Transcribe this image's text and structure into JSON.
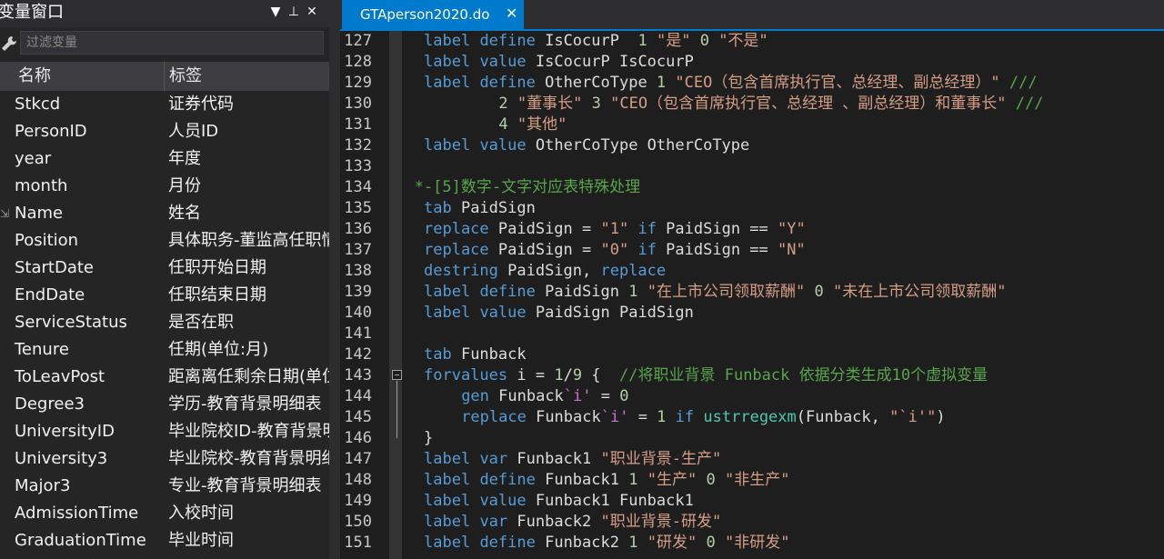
{
  "var_panel": {
    "title": "变量窗口",
    "buttons": {
      "filter": "▼",
      "pin": "⊥",
      "close": "✕"
    },
    "filter_placeholder": "过滤变量",
    "columns": {
      "name": "名称",
      "label": "标签"
    },
    "rows": [
      {
        "name": "Stkcd",
        "label": "证券代码"
      },
      {
        "name": "PersonID",
        "label": "人员ID"
      },
      {
        "name": "year",
        "label": "年度"
      },
      {
        "name": "month",
        "label": "月份"
      },
      {
        "name": "Name",
        "label": "姓名"
      },
      {
        "name": "Position",
        "label": "具体职务-董监高任职情"
      },
      {
        "name": "StartDate",
        "label": "任职开始日期"
      },
      {
        "name": "EndDate",
        "label": "任职结束日期"
      },
      {
        "name": "ServiceStatus",
        "label": "是否在职"
      },
      {
        "name": "Tenure",
        "label": "任期(单位:月)"
      },
      {
        "name": "ToLeavPost",
        "label": "距离离任剩余日期(单位"
      },
      {
        "name": "Degree3",
        "label": "学历-教育背景明细表"
      },
      {
        "name": "UniversityID",
        "label": "毕业院校ID-教育背景明"
      },
      {
        "name": "University3",
        "label": "毕业院校-教育背景明细"
      },
      {
        "name": "Major3",
        "label": "专业-教育背景明细表"
      },
      {
        "name": "AdmissionTime",
        "label": "入校时间"
      },
      {
        "name": "GraduationTime",
        "label": "毕业时间"
      }
    ]
  },
  "editor": {
    "tab_title": "GTAperson2020.do",
    "tab_close": "✕",
    "lines": [
      {
        "n": "127",
        "i": 2,
        "t": [
          [
            "kw",
            "label"
          ],
          [
            "tx",
            " "
          ],
          [
            "kw",
            "define"
          ],
          [
            "tx",
            " IsCocurP  "
          ],
          [
            "num",
            "1"
          ],
          [
            "tx",
            " "
          ],
          [
            "str",
            "\"是\""
          ],
          [
            "tx",
            " "
          ],
          [
            "num",
            "0"
          ],
          [
            "tx",
            " "
          ],
          [
            "str",
            "\"不是\""
          ]
        ]
      },
      {
        "n": "128",
        "i": 2,
        "t": [
          [
            "kw",
            "label"
          ],
          [
            "tx",
            " "
          ],
          [
            "kw",
            "value"
          ],
          [
            "tx",
            " IsCocurP IsCocurP"
          ]
        ]
      },
      {
        "n": "129",
        "i": 2,
        "t": [
          [
            "kw",
            "label"
          ],
          [
            "tx",
            " "
          ],
          [
            "kw",
            "define"
          ],
          [
            "tx",
            " OtherCoType "
          ],
          [
            "num",
            "1"
          ],
          [
            "tx",
            " "
          ],
          [
            "str",
            "\"CEO（包含首席执行官、总经理、副总经理）\""
          ],
          [
            "tx",
            " "
          ],
          [
            "cmt",
            "///"
          ]
        ]
      },
      {
        "n": "130",
        "i": 10,
        "t": [
          [
            "num",
            "2"
          ],
          [
            "tx",
            " "
          ],
          [
            "str",
            "\"董事长\""
          ],
          [
            "tx",
            " "
          ],
          [
            "num",
            "3"
          ],
          [
            "tx",
            " "
          ],
          [
            "str",
            "\"CEO（包含首席执行官、总经理 、副总经理）和董事长\""
          ],
          [
            "tx",
            " "
          ],
          [
            "cmt",
            "///"
          ]
        ]
      },
      {
        "n": "131",
        "i": 10,
        "t": [
          [
            "num",
            "4"
          ],
          [
            "tx",
            " "
          ],
          [
            "str",
            "\"其他\""
          ]
        ]
      },
      {
        "n": "132",
        "i": 2,
        "t": [
          [
            "kw",
            "label"
          ],
          [
            "tx",
            " "
          ],
          [
            "kw",
            "value"
          ],
          [
            "tx",
            " OtherCoType OtherCoType"
          ]
        ]
      },
      {
        "n": "133",
        "i": 0,
        "t": []
      },
      {
        "n": "134",
        "i": 1,
        "t": [
          [
            "cmt",
            "*-[5]数字-文字对应表特殊处理"
          ]
        ]
      },
      {
        "n": "135",
        "i": 2,
        "t": [
          [
            "kw",
            "tab"
          ],
          [
            "tx",
            " PaidSign"
          ]
        ]
      },
      {
        "n": "136",
        "i": 2,
        "t": [
          [
            "kw",
            "replace"
          ],
          [
            "tx",
            " PaidSign = "
          ],
          [
            "str",
            "\"1\""
          ],
          [
            "tx",
            " "
          ],
          [
            "kw",
            "if"
          ],
          [
            "tx",
            " PaidSign == "
          ],
          [
            "str",
            "\"Y\""
          ]
        ]
      },
      {
        "n": "137",
        "i": 2,
        "t": [
          [
            "kw",
            "replace"
          ],
          [
            "tx",
            " PaidSign = "
          ],
          [
            "str",
            "\"0\""
          ],
          [
            "tx",
            " "
          ],
          [
            "kw",
            "if"
          ],
          [
            "tx",
            " PaidSign == "
          ],
          [
            "str",
            "\"N\""
          ]
        ]
      },
      {
        "n": "138",
        "i": 2,
        "t": [
          [
            "kw",
            "destring"
          ],
          [
            "tx",
            " PaidSign, "
          ],
          [
            "kw",
            "replace"
          ]
        ]
      },
      {
        "n": "139",
        "i": 2,
        "t": [
          [
            "kw",
            "label"
          ],
          [
            "tx",
            " "
          ],
          [
            "kw",
            "define"
          ],
          [
            "tx",
            " PaidSign "
          ],
          [
            "num",
            "1"
          ],
          [
            "tx",
            " "
          ],
          [
            "str",
            "\"在上市公司领取薪酬\""
          ],
          [
            "tx",
            " "
          ],
          [
            "num",
            "0"
          ],
          [
            "tx",
            " "
          ],
          [
            "str",
            "\"未在上市公司领取薪酬\""
          ]
        ]
      },
      {
        "n": "140",
        "i": 2,
        "t": [
          [
            "kw",
            "label"
          ],
          [
            "tx",
            " "
          ],
          [
            "kw",
            "value"
          ],
          [
            "tx",
            " PaidSign PaidSign"
          ]
        ]
      },
      {
        "n": "141",
        "i": 0,
        "t": []
      },
      {
        "n": "142",
        "i": 2,
        "t": [
          [
            "kw",
            "tab"
          ],
          [
            "tx",
            " Funback"
          ]
        ]
      },
      {
        "n": "143",
        "i": 2,
        "t": [
          [
            "kw",
            "forvalues"
          ],
          [
            "tx",
            " i = "
          ],
          [
            "num",
            "1"
          ],
          [
            "tx",
            "/"
          ],
          [
            "num",
            "9"
          ],
          [
            "tx",
            " {  "
          ],
          [
            "cmt",
            "//将职业背景 Funback 依据分类生成10个虚拟变量"
          ]
        ]
      },
      {
        "n": "144",
        "i": 6,
        "t": [
          [
            "kw",
            "gen"
          ],
          [
            "tx",
            " Funback"
          ],
          [
            "mac",
            "`i'"
          ],
          [
            "tx",
            " = "
          ],
          [
            "num",
            "0"
          ]
        ]
      },
      {
        "n": "145",
        "i": 6,
        "t": [
          [
            "kw",
            "replace"
          ],
          [
            "tx",
            " Funback"
          ],
          [
            "mac",
            "`i'"
          ],
          [
            "tx",
            " = "
          ],
          [
            "num",
            "1"
          ],
          [
            "tx",
            " "
          ],
          [
            "kw",
            "if"
          ],
          [
            "tx",
            " "
          ],
          [
            "fn",
            "ustrregexm"
          ],
          [
            "tx",
            "(Funback, "
          ],
          [
            "str",
            "\"`i'\""
          ],
          [
            "tx",
            ")"
          ]
        ]
      },
      {
        "n": "146",
        "i": 2,
        "t": [
          [
            "tx",
            "}"
          ]
        ]
      },
      {
        "n": "147",
        "i": 2,
        "t": [
          [
            "kw",
            "label"
          ],
          [
            "tx",
            " "
          ],
          [
            "kw",
            "var"
          ],
          [
            "tx",
            " Funback1 "
          ],
          [
            "str",
            "\"职业背景-生产\""
          ]
        ]
      },
      {
        "n": "148",
        "i": 2,
        "t": [
          [
            "kw",
            "label"
          ],
          [
            "tx",
            " "
          ],
          [
            "kw",
            "define"
          ],
          [
            "tx",
            " Funback1 "
          ],
          [
            "num",
            "1"
          ],
          [
            "tx",
            " "
          ],
          [
            "str",
            "\"生产\""
          ],
          [
            "tx",
            " "
          ],
          [
            "num",
            "0"
          ],
          [
            "tx",
            " "
          ],
          [
            "str",
            "\"非生产\""
          ]
        ]
      },
      {
        "n": "149",
        "i": 2,
        "t": [
          [
            "kw",
            "label"
          ],
          [
            "tx",
            " "
          ],
          [
            "kw",
            "value"
          ],
          [
            "tx",
            " Funback1 Funback1"
          ]
        ]
      },
      {
        "n": "150",
        "i": 2,
        "t": [
          [
            "kw",
            "label"
          ],
          [
            "tx",
            " "
          ],
          [
            "kw",
            "var"
          ],
          [
            "tx",
            " Funback2 "
          ],
          [
            "str",
            "\"职业背景-研发\""
          ]
        ]
      },
      {
        "n": "151",
        "i": 2,
        "t": [
          [
            "kw",
            "label"
          ],
          [
            "tx",
            " "
          ],
          [
            "kw",
            "define"
          ],
          [
            "tx",
            " Funback2 "
          ],
          [
            "num",
            "1"
          ],
          [
            "tx",
            " "
          ],
          [
            "str",
            "\"研发\""
          ],
          [
            "tx",
            " "
          ],
          [
            "num",
            "0"
          ],
          [
            "tx",
            " "
          ],
          [
            "str",
            "\"非研发\""
          ]
        ]
      }
    ]
  }
}
